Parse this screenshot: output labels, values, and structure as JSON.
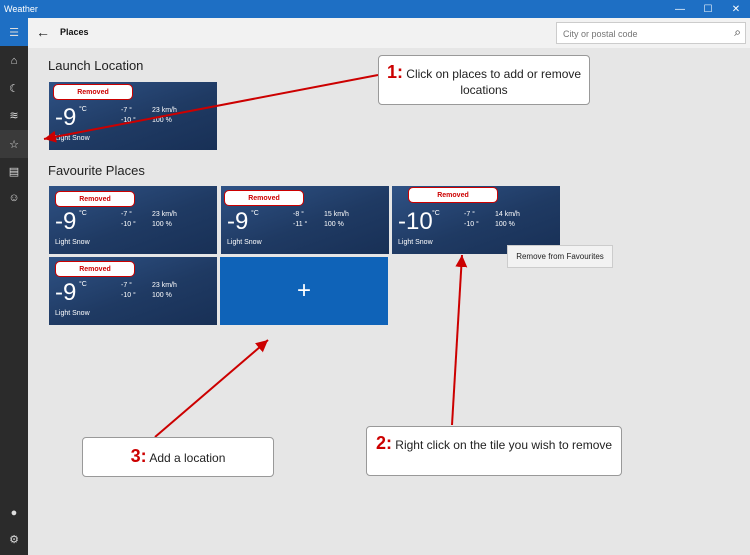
{
  "window": {
    "title": "Weather",
    "minimize": "—",
    "maximize": "☐",
    "close": "✕"
  },
  "header": {
    "back": "←",
    "title": "Places",
    "search_placeholder": "City or postal code",
    "search_icon": "⌕"
  },
  "sidebar": [
    "☰",
    "⌂",
    "☾",
    "≋",
    "☆",
    "▤",
    "☺",
    "●",
    "⚙"
  ],
  "sections": {
    "launch": "Launch Location",
    "favourites": "Favourite Places"
  },
  "badge_text": "Removed",
  "tiles": [
    {
      "temp": "-9",
      "unit": "°C",
      "hi": "-7 °",
      "lo": "-10 °",
      "wind": "23 km/h",
      "hum": "100 %",
      "cond": "Light Snow"
    },
    {
      "temp": "-9",
      "unit": "°C",
      "hi": "-7 °",
      "lo": "-10 °",
      "wind": "23 km/h",
      "hum": "100 %",
      "cond": "Light Snow"
    },
    {
      "temp": "-9",
      "unit": "°C",
      "hi": "-8 °",
      "lo": "-11 °",
      "wind": "15 km/h",
      "hum": "100 %",
      "cond": "Light Snow"
    },
    {
      "temp": "-10",
      "unit": "°C",
      "hi": "-7 °",
      "lo": "-10 °",
      "wind": "14 km/h",
      "hum": "100 %",
      "cond": "Light Snow"
    },
    {
      "temp": "-9",
      "unit": "°C",
      "hi": "-7 °",
      "lo": "-10 °",
      "wind": "23 km/h",
      "hum": "100 %",
      "cond": "Light Snow"
    }
  ],
  "add_tile": "+",
  "context_menu": "Remove from Favourites",
  "callouts": [
    {
      "num": "1:",
      "text": "Click on places to add or remove locations"
    },
    {
      "num": "2:",
      "text": "Right click on the tile you wish to remove"
    },
    {
      "num": "3:",
      "text": "Add a location"
    }
  ]
}
